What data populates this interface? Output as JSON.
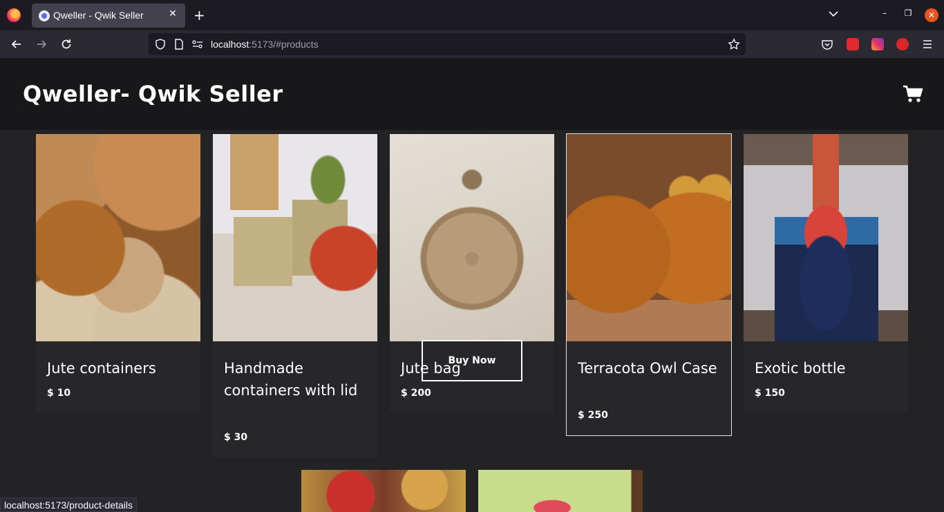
{
  "browser": {
    "tab_title": "Qweller - Qwik Seller",
    "tab_close": "✕",
    "new_tab": "+",
    "url_host": "localhost",
    "url_rest": ":5173/#products",
    "status_url": "localhost:5173/product-details",
    "win_min": "–",
    "win_max": "❐",
    "win_close": "✕"
  },
  "site": {
    "title": "Qweller- Qwik Seller"
  },
  "products": [
    {
      "name": "Jute containers",
      "price": "$ 10"
    },
    {
      "name": "Handmade containers with lid",
      "price": "$ 30"
    },
    {
      "name": "Jute bag",
      "price": "$ 200"
    },
    {
      "name": "Terracota Owl Case",
      "price": "$ 250"
    },
    {
      "name": "Exotic bottle",
      "price": "$ 150"
    }
  ],
  "buy_now_label": "Buy Now",
  "colors": {
    "page_bg": "#232326",
    "header_bg": "#18181b",
    "card_bg": "#27272b"
  }
}
